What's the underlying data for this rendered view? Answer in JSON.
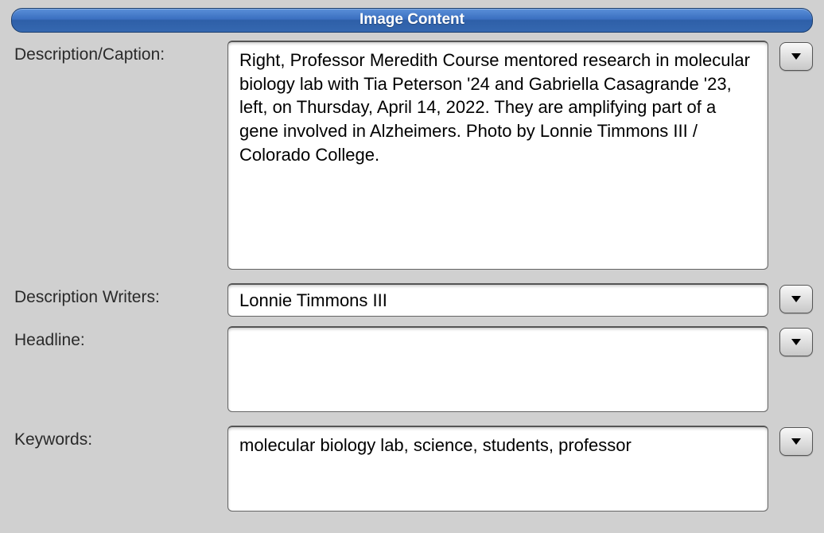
{
  "section_title": "Image Content",
  "labels": {
    "description": "Description/Caption:",
    "writers": "Description Writers:",
    "headline": "Headline:",
    "keywords": "Keywords:"
  },
  "fields": {
    "description": "Right, Professor Meredith Course mentored research in molecular biology lab with Tia Peterson '24 and Gabriella Casagrande '23, left, on Thursday, April 14, 2022. They are amplifying part of a gene involved in Alzheimers. Photo by Lonnie Timmons III / Colorado College.",
    "writers": "Lonnie Timmons III",
    "headline": "",
    "keywords": "molecular biology lab, science, students, professor"
  }
}
